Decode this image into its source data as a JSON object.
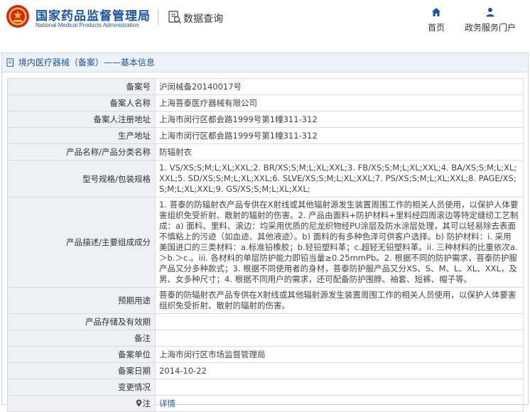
{
  "header": {
    "org_name_cn": "国家药品监督管理局",
    "org_name_en": "National Medical Products Administration",
    "section_title": "数据查询",
    "nav": {
      "home_label": "首页",
      "service_label": "政务服务门户"
    }
  },
  "panel": {
    "title": "境内医疗器械（备案）——基本信息"
  },
  "record": {
    "rows": [
      {
        "label": "备案号",
        "value": "沪闵械备20140017号"
      },
      {
        "label": "备案人名称",
        "value": "上海菩泰医疗器械有限公司"
      },
      {
        "label": "备案人注册地址",
        "value": "上海市闵行区都会路1999号第1幢311-312"
      },
      {
        "label": "生产地址",
        "value": "上海市闵行区都会路1999号第1幢311-312"
      },
      {
        "label": "产品名称/产品分类名称",
        "value": "防辐射衣"
      },
      {
        "label": "型号规格/包装规格",
        "value": "1. VS/XS;S;M;L;XL;XXL;2. BR/XS;S;M;L;XL;XXL;3. FB/XS;S;M;L;XL;XXL;4. BA/XS;S;M;L;XL;XXL;5. SD/XS;S;M;L;XL;XXL;6. SLVE/XS;S;M;L;XL;XXL;7. PS/XS;S;M;L;XL;XXL;8. PAGE/XS;S;M;L;XL;XXL;9. GS/XS;S;M;L;XL;XXL;"
      },
      {
        "label": "产品描述/主要组成成分",
        "value": "1. 菩泰的防辐射衣产品专供在X射线或其他辐射源发生装置周围工作的相关人员使用，以保护人体要害组织免受折射、散射的辐射的伤害。2. 产品由面料+防护材料+里料经四周滚边等特定缝纫工艺制成：a) 面料、里料、滚边：均采用优质的尼龙织物经PU涂层及防水涂层处理，其可以轻易除去表面不慎粘上的污迹（如血迹、其他液迹）。b) 面料的有多种色泽可供客户选择。b) 防护材料：i. 采用美国进口的三类材料：a.标准铅橡胶；b.轻铅塑料革；c.超轻无铅塑料革。ii. 三种材料的比重依次a.＞b.＞c.。iii. 各材料的单层防护能力即铅当量≥0.25mmPb。2. 根据不同的防护需求，菩泰防护服产品又分多种款式；3. 根据不同使用者的身材，菩泰防护服产品又分XS、S、M、L、XL、XXL，及男、女多种尺寸；4. 根据不同用户的需求，还可配备防护围脖、袖套、短裤、帽子等。"
      },
      {
        "label": "预期用途",
        "value": "菩泰的防辐射衣产品专供在X射线或其他辐射源发生装置周围工作的相关人员使用，以保护人体要害组织免受折射、散射的辐射的伤害。"
      },
      {
        "label": "产品存储及有效期",
        "value": ""
      },
      {
        "label": "备注",
        "value": ""
      },
      {
        "label": "备案单位",
        "value": "上海市闵行区市场监督管理局"
      },
      {
        "label": "备案日期",
        "value": "2014-10-22"
      },
      {
        "label": "变更情况",
        "value": ""
      }
    ],
    "note_row": {
      "label": "注",
      "link_text": "详情"
    }
  },
  "colors": {
    "brand_blue": "#1a56a8",
    "label_bg": "#eef0f3",
    "border": "#dcdcdc"
  },
  "icons": {
    "emblem": "national-emblem-icon",
    "database": "data-query-icon",
    "home": "home-icon",
    "service": "user-icon",
    "doc": "document-icon",
    "pin": "location-pin-icon"
  }
}
